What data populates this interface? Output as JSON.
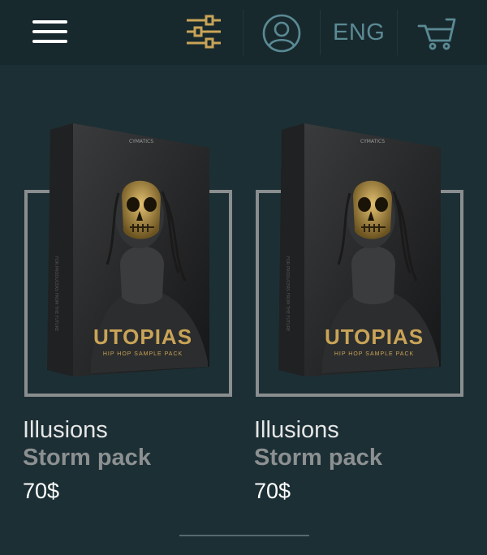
{
  "header": {
    "language_label": "ENG",
    "icons": {
      "menu": "hamburger-menu-icon",
      "filter": "sliders-filter-icon",
      "account": "user-account-icon",
      "cart": "shopping-cart-icon"
    },
    "colors": {
      "filter_icon": "#c9a457",
      "account_icon": "#5a8a94",
      "cart_icon": "#5a8a94",
      "background": "#18292e"
    }
  },
  "products": [
    {
      "brand": "Illusions",
      "name": "Storm pack",
      "price": "70$",
      "image": {
        "publisher": "CYMATICS",
        "cover_title": "UTOPIAS",
        "cover_subtitle": "HIP HOP SAMPLE PACK",
        "spine_text": "FOR PRODUCERS FROM THE FUTURE"
      }
    },
    {
      "brand": "Illusions",
      "name": "Storm pack",
      "price": "70$",
      "image": {
        "publisher": "CYMATICS",
        "cover_title": "UTOPIAS",
        "cover_subtitle": "HIP HOP SAMPLE PACK",
        "spine_text": "FOR PRODUCERS FROM THE FUTURE"
      }
    }
  ],
  "colors": {
    "page_background": "#1c2f35",
    "frame": "#8a8e8f",
    "gold": "#c9a457"
  }
}
